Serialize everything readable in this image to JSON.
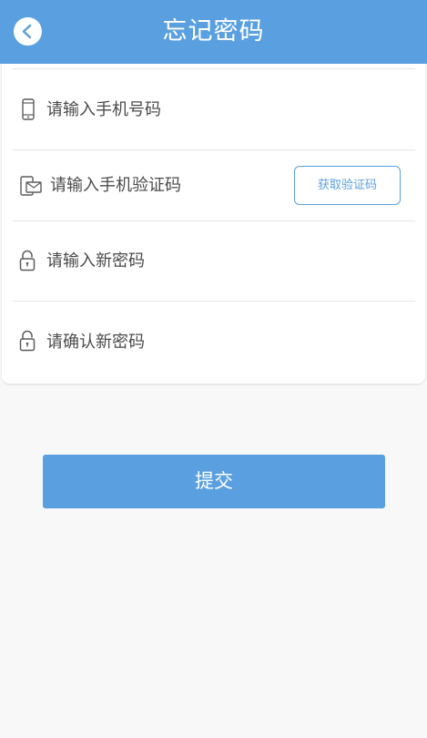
{
  "header": {
    "title": "忘记密码",
    "back_icon": "chevron-left-icon"
  },
  "form": {
    "phone_placeholder": "请输入手机号码",
    "code_placeholder": "请输入手机验证码",
    "get_code_label": "获取验证码",
    "new_password_placeholder": "请输入新密码",
    "confirm_password_placeholder": "请确认新密码"
  },
  "submit_label": "提交",
  "colors": {
    "accent": "#5aa0e0",
    "background": "#f8f8f8",
    "card": "#ffffff",
    "text": "#4a4a4a"
  }
}
